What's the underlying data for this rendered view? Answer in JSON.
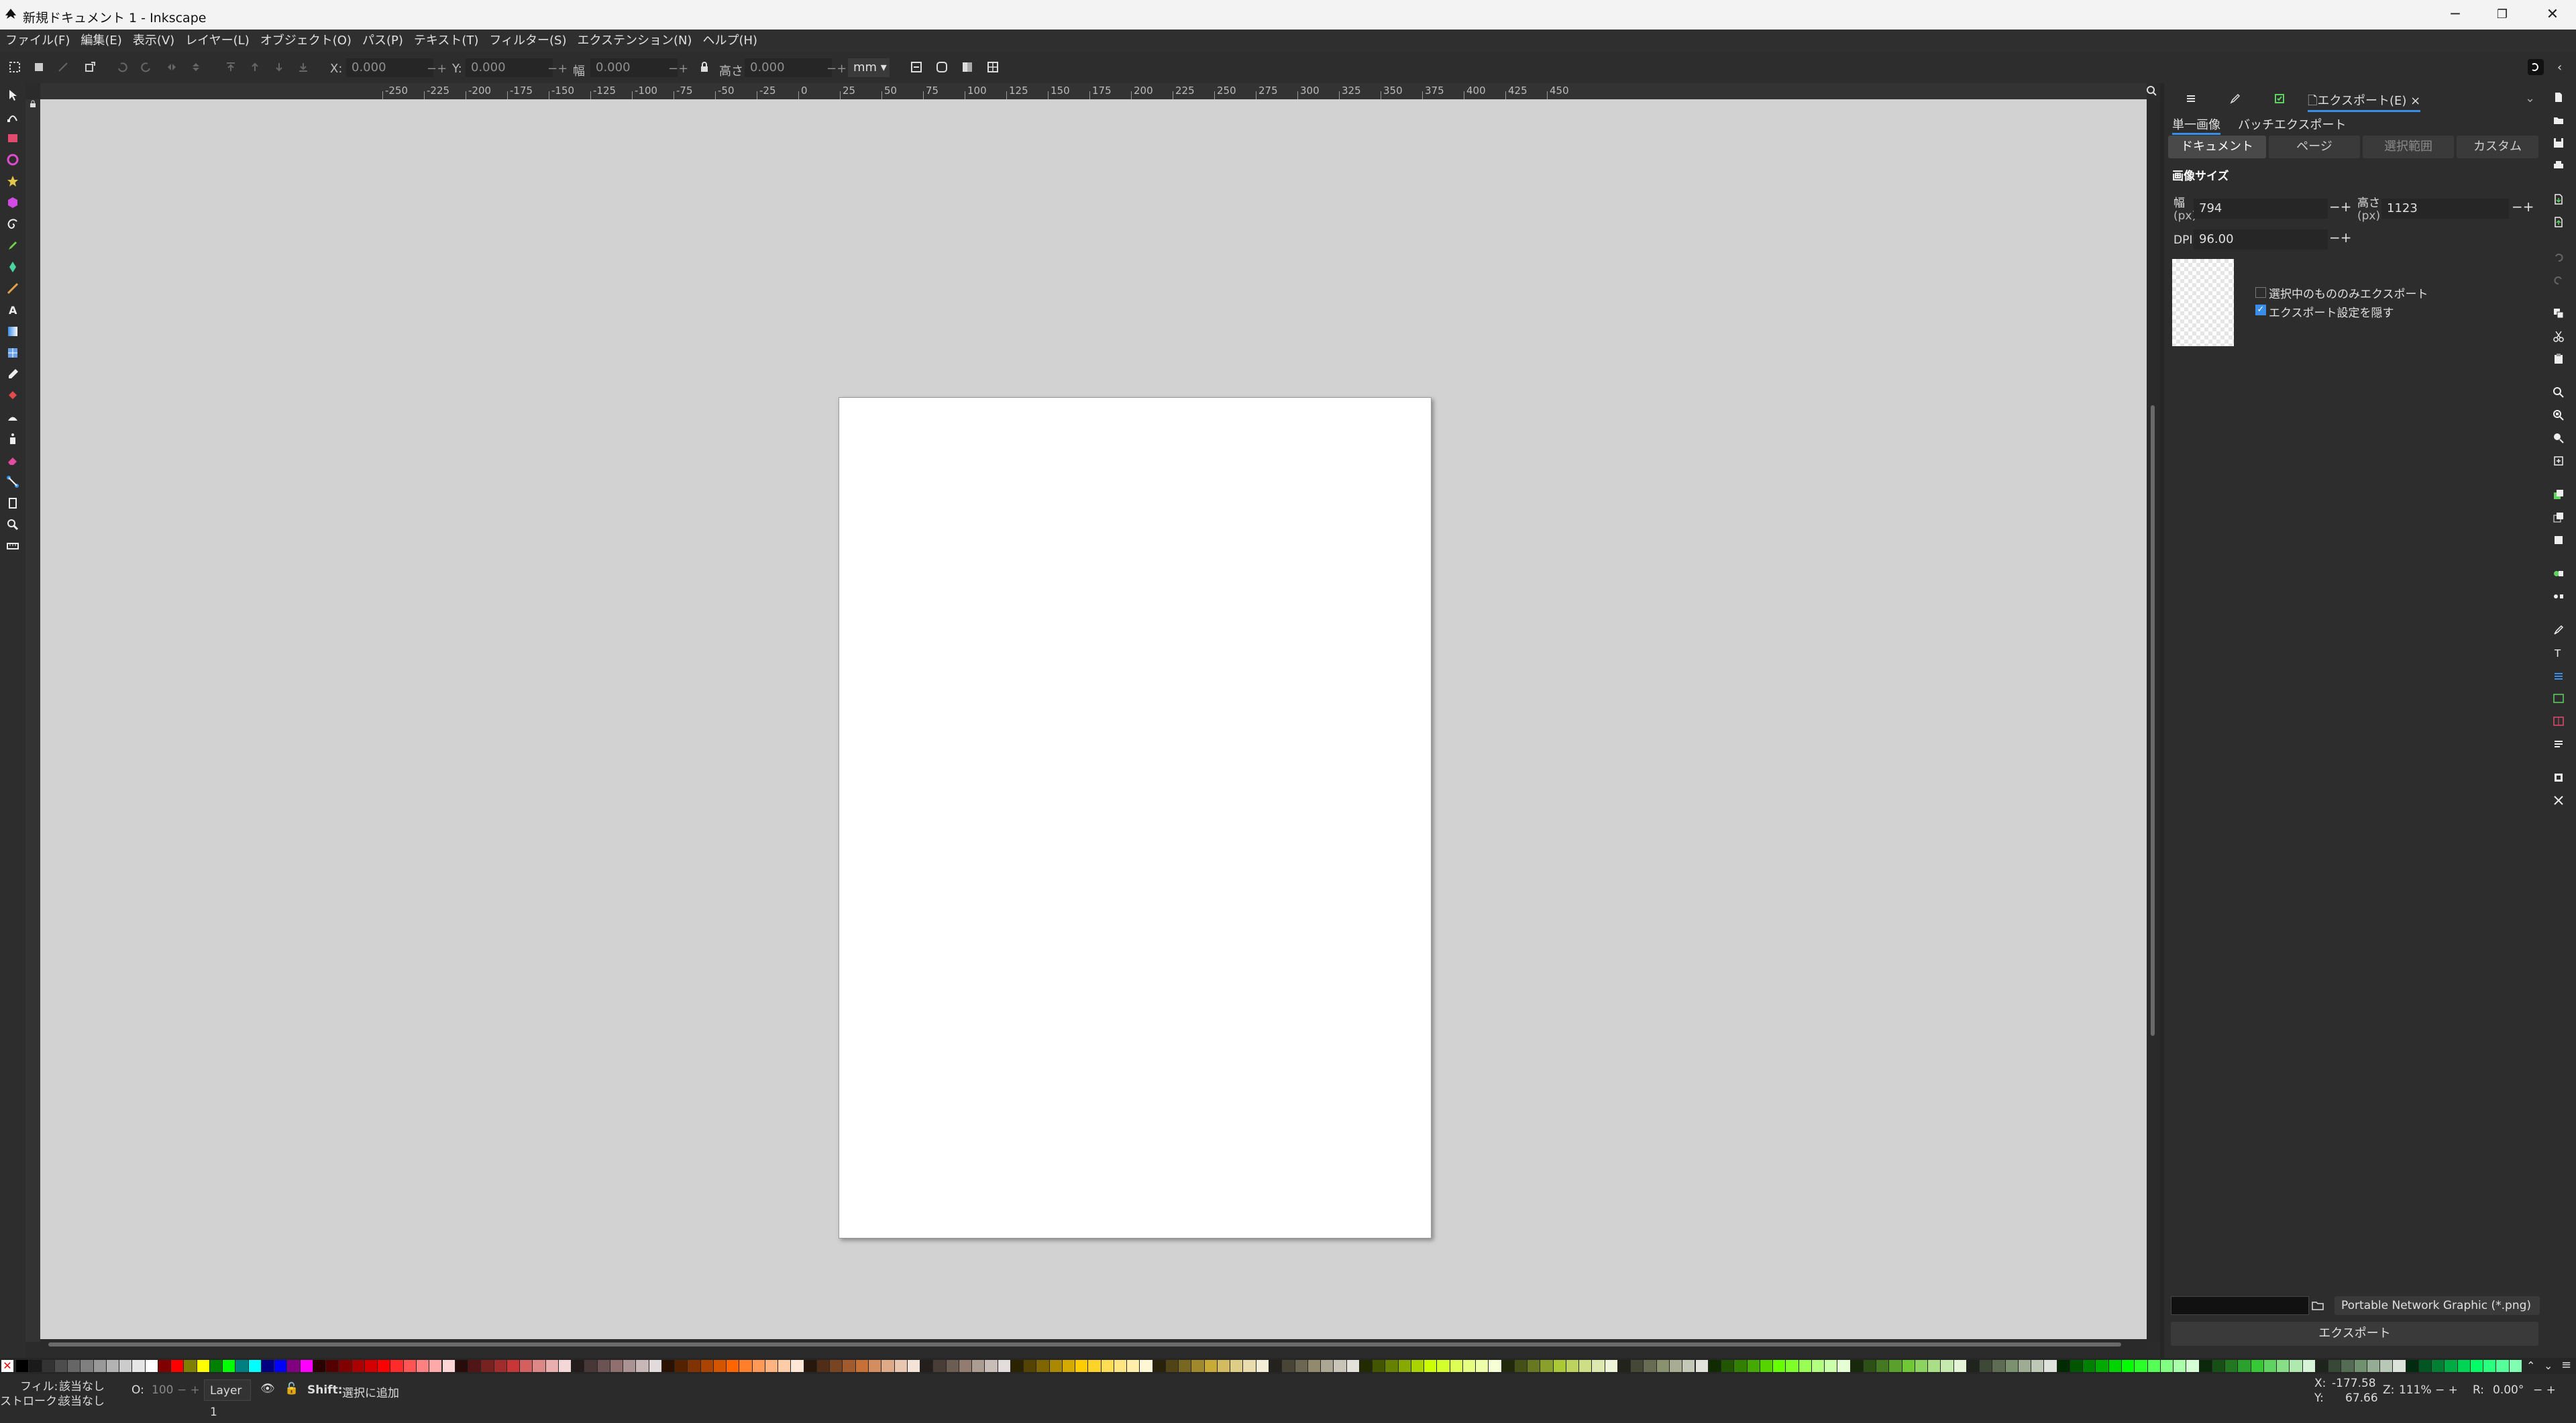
{
  "window": {
    "title": "新規ドキュメント 1 - Inkscape",
    "buttons": {
      "minimize": "─",
      "restore": "❐",
      "close": "✕"
    }
  },
  "menu": [
    {
      "label": "ファイル(F)"
    },
    {
      "label": "編集(E)"
    },
    {
      "label": "表示(V)"
    },
    {
      "label": "レイヤー(L)"
    },
    {
      "label": "オブジェクト(O)"
    },
    {
      "label": "パス(P)"
    },
    {
      "label": "テキスト(T)"
    },
    {
      "label": "フィルター(S)"
    },
    {
      "label": "エクステンション(N)"
    },
    {
      "label": "ヘルプ(H)"
    }
  ],
  "toolbar": {
    "x_label": "X:",
    "x_value": "0.000",
    "y_label": "Y:",
    "y_value": "0.000",
    "w_label": "幅",
    "w_value": "0.000",
    "h_label": "高さ",
    "h_value": "0.000",
    "unit": "mm",
    "plus_minus": "−+"
  },
  "ruler": {
    "top_ticks": [
      "-250",
      "-225",
      "-200",
      "-175",
      "-150",
      "-125",
      "-100",
      "-75",
      "-50",
      "-25",
      "0",
      "25",
      "50",
      "75",
      "100",
      "125",
      "150",
      "175",
      "200",
      "225",
      "250",
      "275",
      "300",
      "325",
      "350",
      "375",
      "400",
      "425",
      "450"
    ]
  },
  "dock": {
    "tabs": [
      {
        "name": "layers-tab",
        "label": ""
      },
      {
        "name": "xml-tab",
        "label": ""
      },
      {
        "name": "fill-tab",
        "label": ""
      },
      {
        "name": "export-tab",
        "label": "エクスポート(E)",
        "close": "×"
      }
    ],
    "export_mode": {
      "single": "単一画像",
      "batch": "バッチエクスポート"
    },
    "segments": [
      "ドキュメント",
      "ページ",
      "選択範囲",
      "カスタム"
    ],
    "image_size_title": "画像サイズ",
    "width_label": "幅",
    "width_unit": "(px)",
    "width_value": "794",
    "height_label": "高さ",
    "height_unit": "(px)",
    "height_value": "1123",
    "dpi_label": "DPI",
    "dpi_value": "96.00",
    "pm": "−+",
    "only_selected": "選択中のもののみエクスポート",
    "hide_settings": "エクスポート設定を隠す",
    "hide_settings_checked": true,
    "format": "Portable Network Graphic (*.png)",
    "export_button": "エクスポート"
  },
  "status": {
    "fill_label": "フィル:",
    "fill_value": "該当なし",
    "stroke_label": "ストローク:",
    "stroke_value": "該当なし",
    "opacity_label": "O:",
    "opacity_value": "100",
    "layer": "Layer 1",
    "message_bold": "Shift:",
    "message": "選択に追加",
    "x_label": "X:",
    "x_value": "-177.58",
    "y_label": "Y:",
    "y_value": "67.66",
    "zoom_label": "Z:",
    "zoom_value": "111%",
    "rotate_label": "R:",
    "rotate_value": "0.00°"
  },
  "colors": {
    "accent": "#3a8ee6",
    "canvas": "#d2d2d2",
    "page": "#ffffff",
    "ui": "#2d2d2d"
  },
  "palette": [
    "#000000",
    "#1a1a1a",
    "#333333",
    "#4d4d4d",
    "#666666",
    "#808080",
    "#999999",
    "#b3b3b3",
    "#cccccc",
    "#e6e6e6",
    "#ffffff",
    "#800000",
    "#ff0000",
    "#808000",
    "#ffff00",
    "#008000",
    "#00ff00",
    "#008080",
    "#00ffff",
    "#000080",
    "#0000ff",
    "#800080",
    "#ff00ff",
    "#2b0000",
    "#550000",
    "#800000",
    "#aa0000",
    "#d40000",
    "#ff0000",
    "#ff2a2a",
    "#ff5555",
    "#ff8080",
    "#ffaaaa",
    "#ffd5d5",
    "#280b0b",
    "#501616",
    "#782121",
    "#a02c2c",
    "#c83737",
    "#d35f5f",
    "#de8787",
    "#e9afaf",
    "#f4d7d7",
    "#241c1c",
    "#483737",
    "#6c5353",
    "#916f6f",
    "#ac9393",
    "#c8b7b7",
    "#e3dbdb",
    "#2b1100",
    "#552200",
    "#803300",
    "#aa4400",
    "#d45500",
    "#ff6600",
    "#ff7f2a",
    "#ff9955",
    "#ffb380",
    "#ffccaa",
    "#ffe6d5",
    "#28170b",
    "#502d16",
    "#784421",
    "#a05a2c",
    "#c87137",
    "#d38d5f",
    "#deaa87",
    "#e9c6af",
    "#f4e3d7",
    "#241f1c",
    "#483e37",
    "#6c5d53",
    "#917c6f",
    "#ac9d93",
    "#c8beb7",
    "#e3dedb",
    "#2b2200",
    "#554400",
    "#806600",
    "#aa8800",
    "#d4aa00",
    "#ffcc00",
    "#ffd42a",
    "#ffdd55",
    "#ffe680",
    "#ffeeaa",
    "#fff6d5",
    "#28220b",
    "#504416",
    "#786721",
    "#a0892c",
    "#c8ab37",
    "#d3bc5f",
    "#decd87",
    "#e9ddaf",
    "#f4eed7",
    "#24221c",
    "#484537",
    "#6c6753",
    "#918a6f",
    "#aca793",
    "#c8c4b7",
    "#e3e2db",
    "#222b00",
    "#445500",
    "#668000",
    "#88aa00",
    "#aad400",
    "#ccff00",
    "#d4ff2a",
    "#ddff55",
    "#e5ff80",
    "#eeffaa",
    "#f6ffd5",
    "#22280b",
    "#445016",
    "#677821",
    "#89a02c",
    "#abc837",
    "#bcd35f",
    "#cdde87",
    "#dde9af",
    "#eef4d7",
    "#22241c",
    "#454837",
    "#676c53",
    "#8a916f",
    "#a7ac93",
    "#c4c8b7",
    "#e2e3db",
    "#112b00",
    "#225500",
    "#338000",
    "#44aa00",
    "#55d400",
    "#66ff00",
    "#7fff2a",
    "#99ff55",
    "#b3ff80",
    "#ccffaa",
    "#e5ffd5",
    "#17280b",
    "#2d5016",
    "#447821",
    "#5aa02c",
    "#71c837",
    "#8dd35f",
    "#aade87",
    "#c6e9af",
    "#e3f4d7",
    "#1f241c",
    "#3e4837",
    "#5d6c53",
    "#7c916f",
    "#9dac93",
    "#bec8b7",
    "#dee3db",
    "#002b00",
    "#005500",
    "#008000",
    "#00aa00",
    "#00d400",
    "#00ff00",
    "#2aff2a",
    "#55ff55",
    "#80ff80",
    "#aaffaa",
    "#d5ffd5",
    "#0b280b",
    "#165016",
    "#217821",
    "#2ca02c",
    "#37c837",
    "#5fd35f",
    "#87de87",
    "#afe9af",
    "#d7f4d7",
    "#1c241c",
    "#374837",
    "#536c53",
    "#6f916f",
    "#93ac93",
    "#b7c8b7",
    "#dbe3db",
    "#002b11",
    "#005522",
    "#008033",
    "#00aa44",
    "#00d455",
    "#00ff66",
    "#2aff80",
    "#55ff99",
    "#80ffb3"
  ]
}
